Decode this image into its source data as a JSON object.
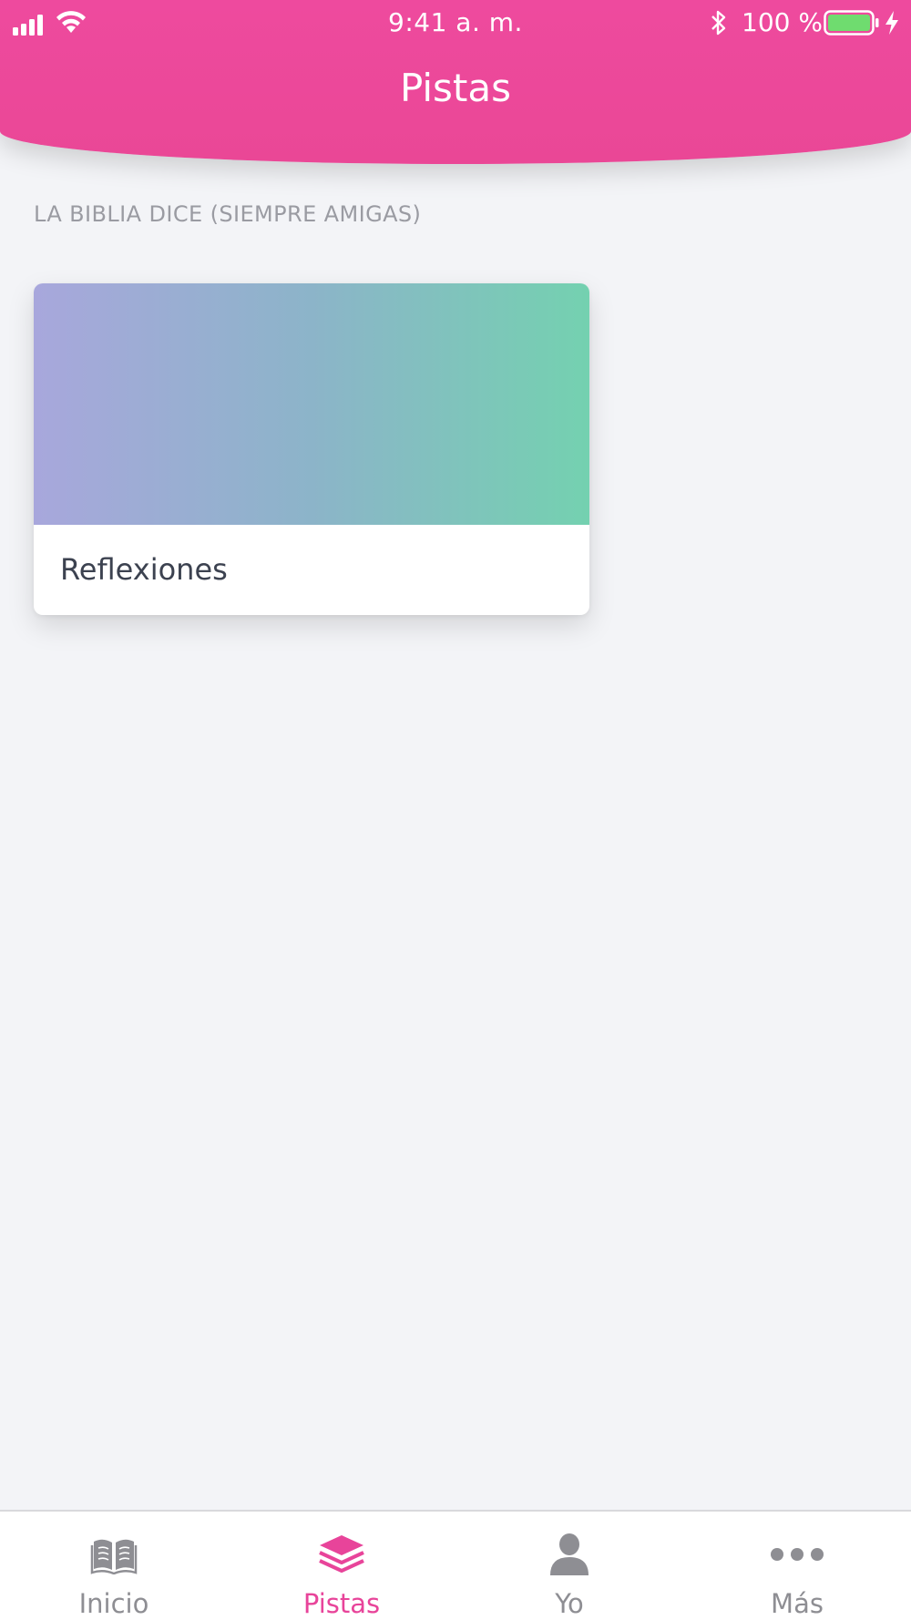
{
  "status_bar": {
    "time": "9:41 a. m.",
    "battery_percent": "100 %",
    "icons": [
      "signal-icon",
      "wifi-icon",
      "bluetooth-icon",
      "battery-icon",
      "charging-bolt-icon"
    ]
  },
  "header": {
    "title": "Pistas",
    "color": "#EC4899"
  },
  "section": {
    "label": "LA BIBLIA DICE (SIEMPRE AMIGAS)"
  },
  "cards": [
    {
      "title": "Reflexiones",
      "gradient": [
        "#A8A7DC",
        "#74D1B0"
      ]
    }
  ],
  "tabbar": {
    "active_color": "#E8449A",
    "inactive_color": "#8E8E93",
    "tabs": [
      {
        "label": "Inicio",
        "icon": "book-icon",
        "active": false
      },
      {
        "label": "Pistas",
        "icon": "layers-icon",
        "active": true
      },
      {
        "label": "Yo",
        "icon": "person-icon",
        "active": false
      },
      {
        "label": "Más",
        "icon": "more-dots-icon",
        "active": false
      }
    ]
  }
}
